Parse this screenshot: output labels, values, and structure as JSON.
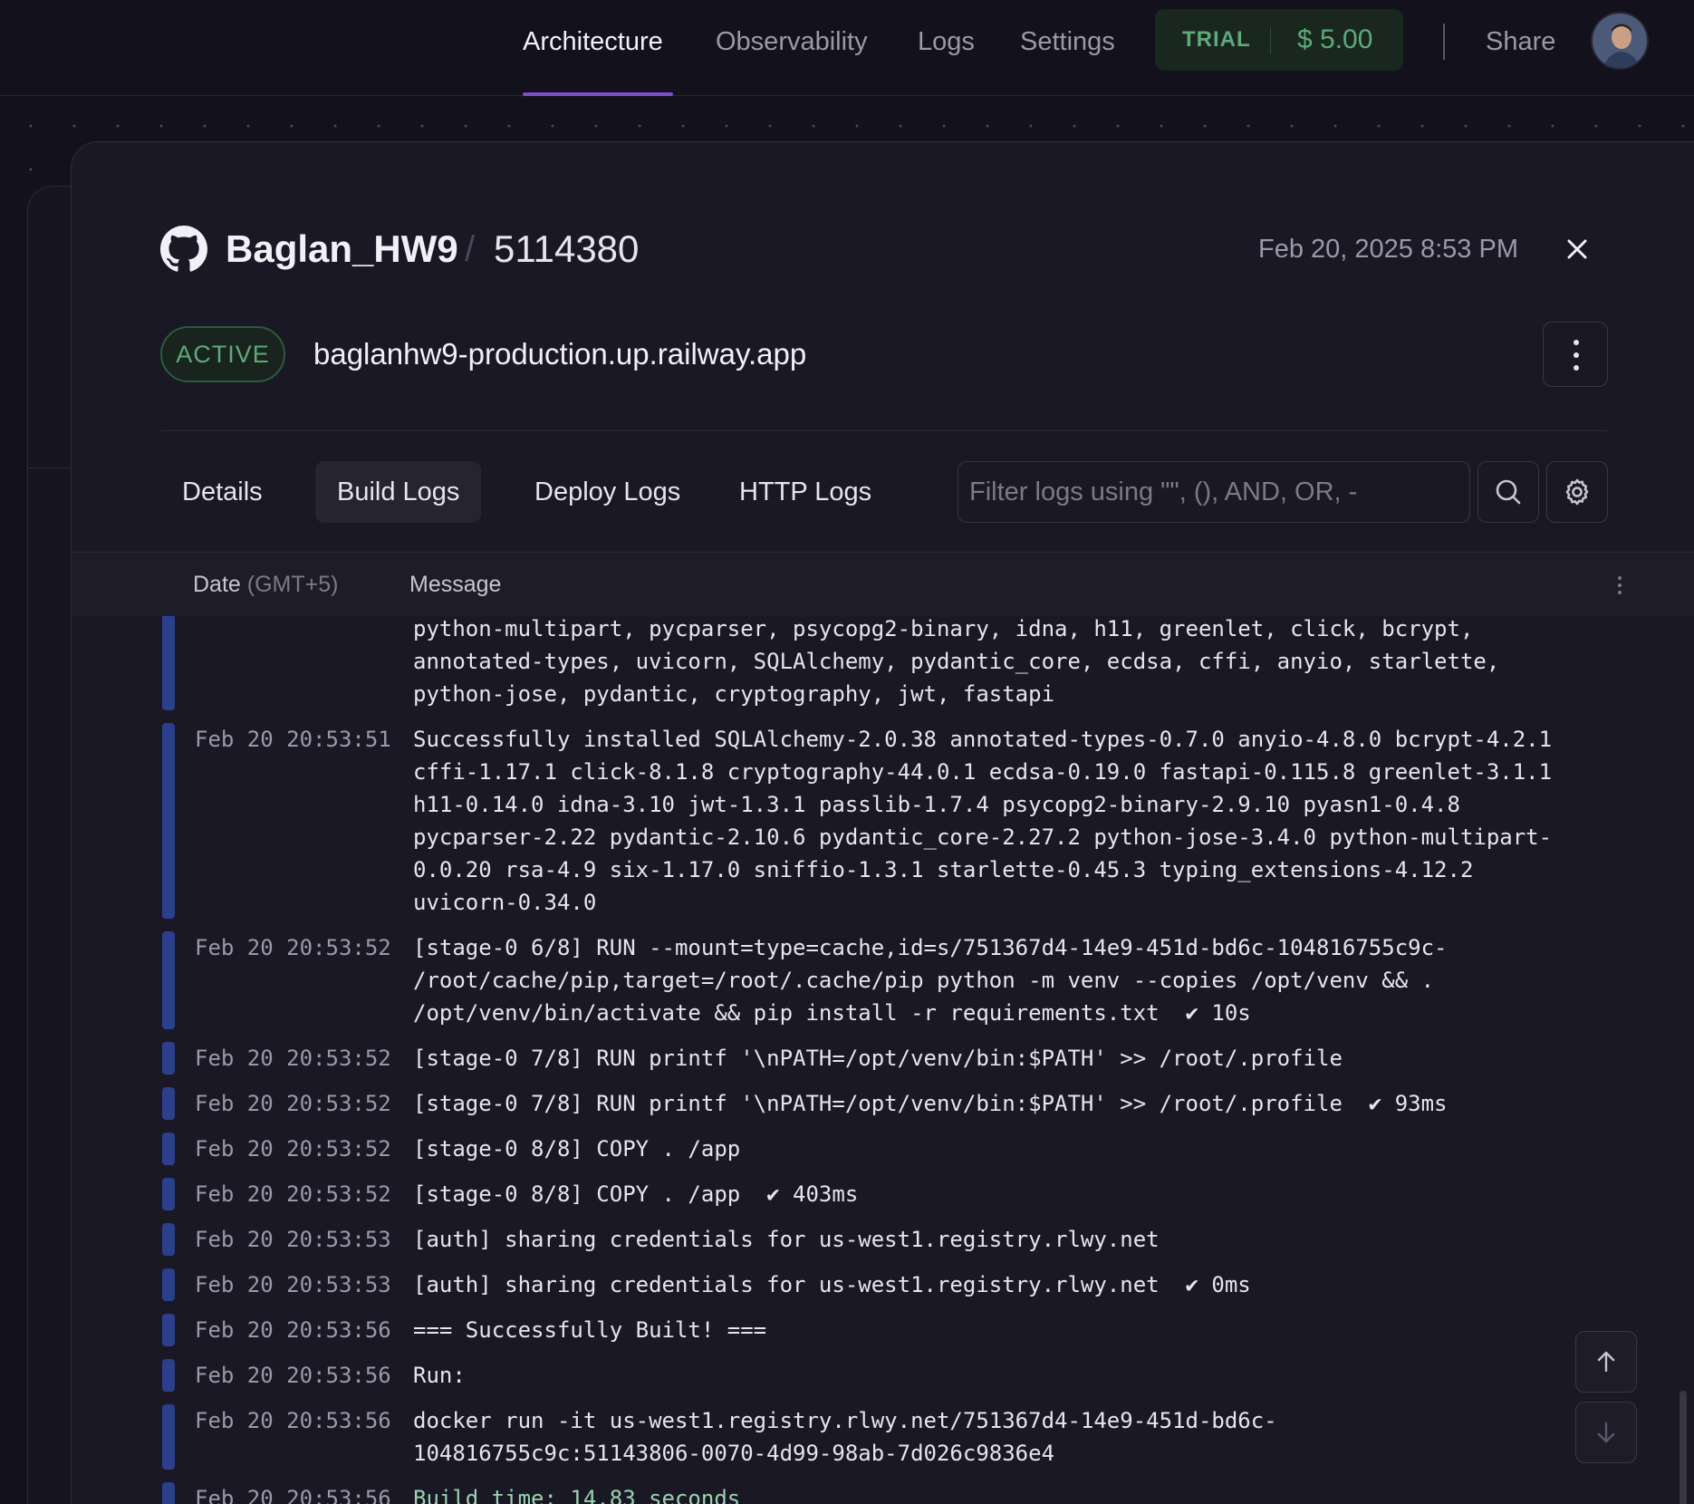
{
  "nav": {
    "tabs": [
      {
        "label": "Architecture"
      },
      {
        "label": "Observability"
      },
      {
        "label": "Logs"
      },
      {
        "label": "Settings"
      }
    ],
    "trial_label": "TRIAL",
    "trial_amount": "$ 5.00",
    "share_label": "Share"
  },
  "deployment": {
    "service_name": "Baglan_HW9",
    "separator": "/",
    "deploy_id": "5114380",
    "date": "Feb 20, 2025 8:53 PM",
    "close_glyph": "✕",
    "status": "ACTIVE",
    "domain": "baglanhw9-production.up.railway.app"
  },
  "tabs": [
    {
      "label": "Details"
    },
    {
      "label": "Build Logs"
    },
    {
      "label": "Deploy Logs"
    },
    {
      "label": "HTTP Logs"
    }
  ],
  "filter": {
    "placeholder": "Filter logs using \"\", (), AND, OR, -"
  },
  "table": {
    "date_header": "Date",
    "date_tz": "(GMT+5)",
    "message_header": "Message"
  },
  "logs": [
    {
      "ts": "",
      "msg": "python-multipart, pycparser, psycopg2-binary, idna, h11, greenlet, click, bcrypt,\nannotated-types, uvicorn, SQLAlchemy, pydantic_core, ecdsa, cffi, anyio, starlette,\npython-jose, pydantic, cryptography, jwt, fastapi"
    },
    {
      "ts": "Feb 20 20:53:51",
      "msg": "Successfully installed SQLAlchemy-2.0.38 annotated-types-0.7.0 anyio-4.8.0 bcrypt-4.2.1\ncffi-1.17.1 click-8.1.8 cryptography-44.0.1 ecdsa-0.19.0 fastapi-0.115.8 greenlet-3.1.1\nh11-0.14.0 idna-3.10 jwt-1.3.1 passlib-1.7.4 psycopg2-binary-2.9.10 pyasn1-0.4.8\npycparser-2.22 pydantic-2.10.6 pydantic_core-2.27.2 python-jose-3.4.0 python-multipart-\n0.0.20 rsa-4.9 six-1.17.0 sniffio-1.3.1 starlette-0.45.3 typing_extensions-4.12.2\nuvicorn-0.34.0"
    },
    {
      "ts": "Feb 20 20:53:52",
      "msg": "[stage-0 6/8] RUN --mount=type=cache,id=s/751367d4-14e9-451d-bd6c-104816755c9c-\n/root/cache/pip,target=/root/.cache/pip python -m venv --copies /opt/venv && .\n/opt/venv/bin/activate && pip install -r requirements.txt  ✔ 10s"
    },
    {
      "ts": "Feb 20 20:53:52",
      "msg": "[stage-0 7/8] RUN printf '\\nPATH=/opt/venv/bin:$PATH' >> /root/.profile"
    },
    {
      "ts": "Feb 20 20:53:52",
      "msg": "[stage-0 7/8] RUN printf '\\nPATH=/opt/venv/bin:$PATH' >> /root/.profile  ✔ 93ms"
    },
    {
      "ts": "Feb 20 20:53:52",
      "msg": "[stage-0 8/8] COPY . /app"
    },
    {
      "ts": "Feb 20 20:53:52",
      "msg": "[stage-0 8/8] COPY . /app  ✔ 403ms"
    },
    {
      "ts": "Feb 20 20:53:53",
      "msg": "[auth] sharing credentials for us-west1.registry.rlwy.net"
    },
    {
      "ts": "Feb 20 20:53:53",
      "msg": "[auth] sharing credentials for us-west1.registry.rlwy.net  ✔ 0ms"
    },
    {
      "ts": "Feb 20 20:53:56",
      "msg": "=== Successfully Built! ==="
    },
    {
      "ts": "Feb 20 20:53:56",
      "msg": "Run:"
    },
    {
      "ts": "Feb 20 20:53:56",
      "msg": "docker run -it us-west1.registry.rlwy.net/751367d4-14e9-451d-bd6c-\n104816755c9c:51143806-0070-4d99-98ab-7d026c9836e4"
    },
    {
      "ts": "Feb 20 20:53:56",
      "msg": "Build time: 14.83 seconds",
      "kind": "success"
    }
  ],
  "colors": {
    "accent": "#7c4dcc",
    "success": "#5fa97b",
    "log_bar": "#2b3f8c"
  }
}
